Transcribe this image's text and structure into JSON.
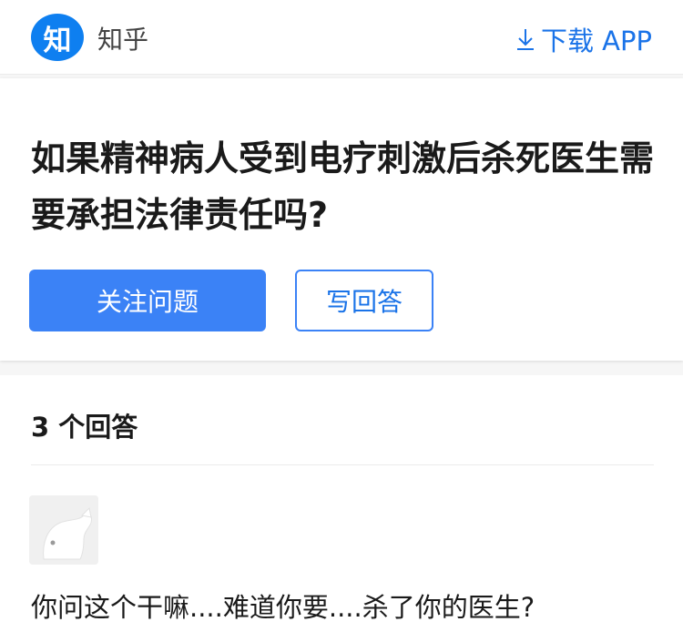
{
  "header": {
    "logo_char": "知",
    "brand": "知乎",
    "download_label": "下载 APP",
    "download_icon": "download-arrow-icon",
    "accent_color": "#1a73e8"
  },
  "question": {
    "title": "如果精神病人受到电疗刺激后杀死医生需要承担法律责任吗?",
    "follow_label": "关注问题",
    "write_answer_label": "写回答"
  },
  "answers": {
    "count_label": "3 个回答",
    "items": [
      {
        "avatar_icon": "default-avatar-icon",
        "excerpt": "你问这个干嘛....难道你要....杀了你的医生?"
      }
    ]
  }
}
